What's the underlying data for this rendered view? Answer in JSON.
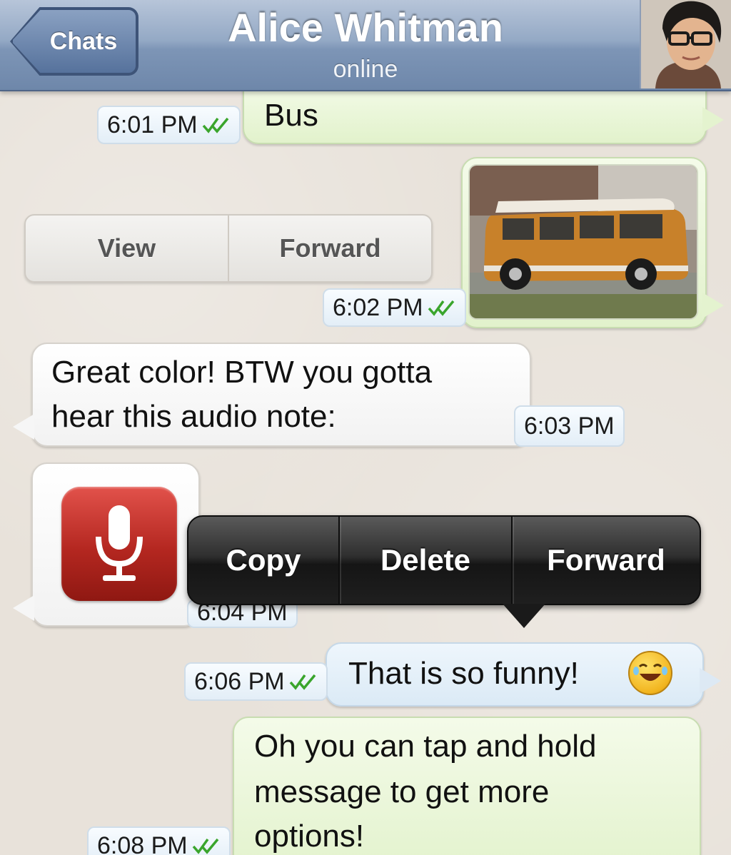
{
  "nav": {
    "back_label": "Chats",
    "contact_name": "Alice Whitman",
    "status": "online"
  },
  "messages": {
    "bus": {
      "text": "Bus",
      "time": "6:01 PM"
    },
    "photo": {
      "time": "6:02 PM",
      "view_label": "View",
      "forward_label": "Forward"
    },
    "great_color": {
      "line1": "Great color! BTW you gotta",
      "line2": "hear this audio note:",
      "time": "6:03 PM"
    },
    "audio": {
      "time": "6:04 PM"
    },
    "funny": {
      "text": "That is so funny!",
      "time": "6:06 PM"
    },
    "tap_hold": {
      "line1": "Oh you can tap and hold",
      "line2": "message to get more",
      "line3": "options!",
      "time": "6:08 PM"
    }
  },
  "context_menu": {
    "items": [
      "Copy",
      "Delete",
      "Forward"
    ]
  },
  "colors": {
    "navbar": "#7d95b6",
    "outgoing_bubble": "#e2f2cc",
    "incoming_bubble": "#ffffff",
    "check_mark": "#3aa52c",
    "context_menu": "#2f2f2f",
    "audio_icon": "#b42720"
  },
  "icons": [
    "back-chevron-icon",
    "double-check-icon",
    "microphone-icon",
    "laughing-emoji-icon"
  ]
}
